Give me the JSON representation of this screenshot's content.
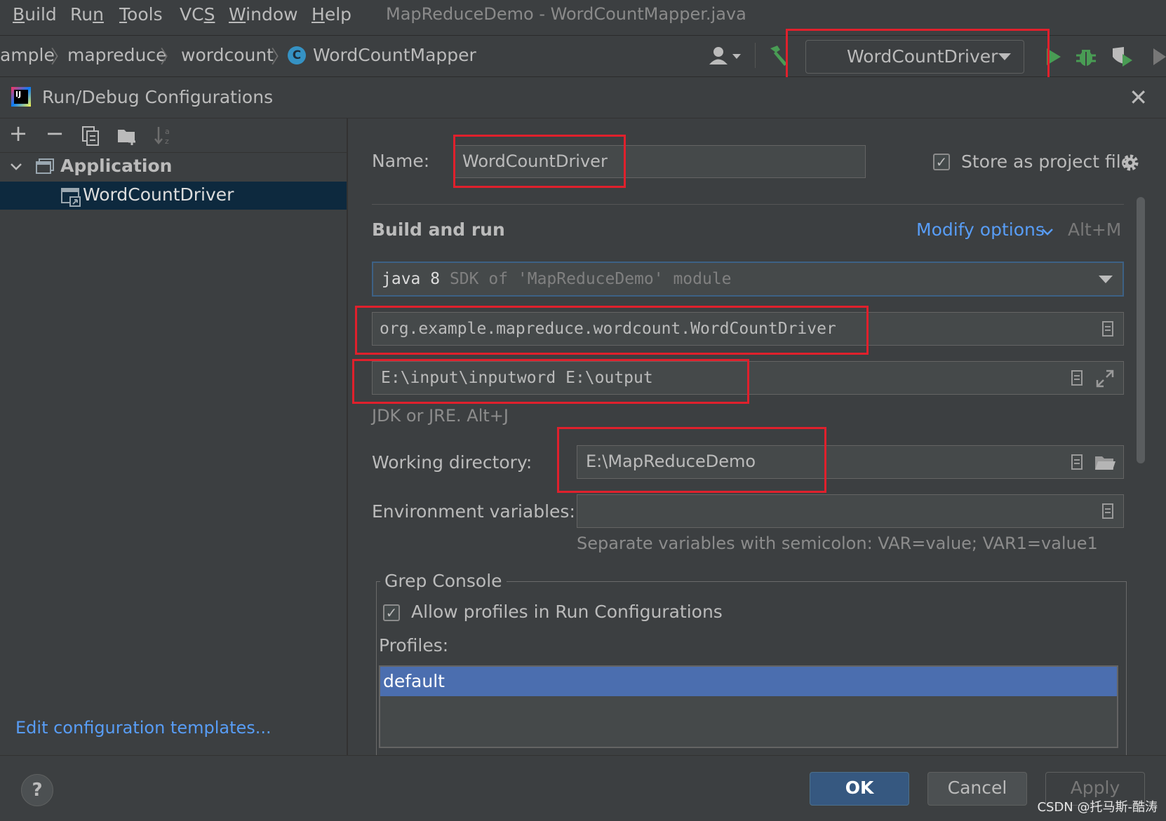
{
  "menubar": {
    "items": [
      {
        "underline": "B",
        "rest": "uild"
      },
      {
        "underline": "",
        "rest": "Ru",
        "underline2": "n",
        "rest2": ""
      },
      {
        "underline": "T",
        "rest": "ools"
      },
      {
        "underline": "",
        "rest": "VC",
        "underline2": "S",
        "rest2": ""
      },
      {
        "underline": "W",
        "rest": "indow"
      },
      {
        "underline": "H",
        "rest": "elp"
      }
    ],
    "window_title": "MapReduceDemo - WordCountMapper.java"
  },
  "navbar": {
    "crumbs": [
      "ample",
      "mapreduce",
      "wordcount",
      "WordCountMapper"
    ],
    "class_icon_letter": "C",
    "run_config": "WordCountDriver"
  },
  "dialog": {
    "title": "Run/Debug Configurations",
    "close": "✕"
  },
  "left_panel": {
    "toolbar": [
      "+",
      "−",
      "⧉",
      "▰",
      "⇅"
    ],
    "tree": {
      "group": "Application",
      "selected": "WordCountDriver"
    },
    "edit_templates": "Edit configuration templates..."
  },
  "form": {
    "name_label": "Name:",
    "name_value": "WordCountDriver",
    "store_label": "Store as project file",
    "section_title": "Build and run",
    "modify_options": "Modify options",
    "modify_shortcut": "Alt+M",
    "jdk_value": "java 8",
    "jdk_hint": "SDK of 'MapReduceDemo' module",
    "main_class": "org.example.mapreduce.wordcount.WordCountDriver",
    "program_args": "E:\\input\\inputword E:\\output",
    "jre_hint": "JDK or JRE. Alt+J",
    "workdir_label": "Working directory:",
    "workdir_value": "E:\\MapReduceDemo",
    "env_label": "Environment variables:",
    "env_value": "",
    "env_hint": "Separate variables with semicolon: VAR=value; VAR1=value1",
    "grep_title": "Grep Console",
    "grep_allow": "Allow profiles in Run Configurations",
    "profiles_label": "Profiles:",
    "profiles": [
      "default"
    ]
  },
  "buttons": {
    "help": "?",
    "ok": "OK",
    "cancel": "Cancel",
    "apply": "Apply"
  },
  "watermark": "CSDN @托马斯-酷涛",
  "colors": {
    "highlight": "#e0202c",
    "link": "#589df6",
    "selection": "#4b6eaf",
    "run_green": "#499c54"
  }
}
